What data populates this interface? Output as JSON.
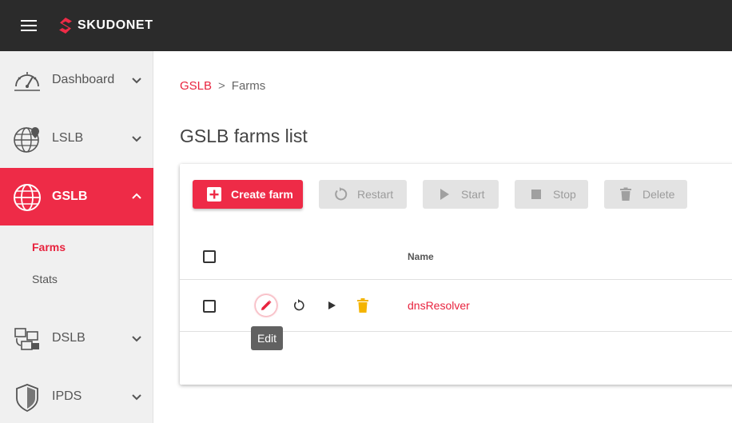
{
  "app": {
    "brand": "SKUDONET",
    "brand_color": "#ee2b47"
  },
  "topbar": {
    "menu_icon": "hamburger-icon"
  },
  "sidebar": {
    "items": [
      {
        "label": "Dashboard",
        "icon": "dashboard-gauge-icon",
        "expanded": false
      },
      {
        "label": "LSLB",
        "icon": "globe-pin-icon",
        "expanded": false
      },
      {
        "label": "GSLB",
        "icon": "globe-icon",
        "expanded": true,
        "active": true
      },
      {
        "label": "DSLB",
        "icon": "servers-icon",
        "expanded": false
      },
      {
        "label": "IPDS",
        "icon": "shield-icon",
        "expanded": false
      }
    ],
    "gslb_subitems": [
      {
        "label": "Farms",
        "active": true
      },
      {
        "label": "Stats",
        "active": false
      }
    ]
  },
  "breadcrumb": {
    "root": "GSLB",
    "separator": ">",
    "current": "Farms"
  },
  "page_title": "GSLB farms list",
  "toolbar": {
    "create": "Create farm",
    "restart": "Restart",
    "start": "Start",
    "stop": "Stop",
    "delete": "Delete"
  },
  "table": {
    "columns": [
      "Name"
    ],
    "rows": [
      {
        "name": "dnsResolver",
        "actions": [
          "edit-icon",
          "restart-icon",
          "start-icon",
          "delete-icon"
        ]
      }
    ]
  },
  "tooltip": {
    "text": "Edit"
  }
}
